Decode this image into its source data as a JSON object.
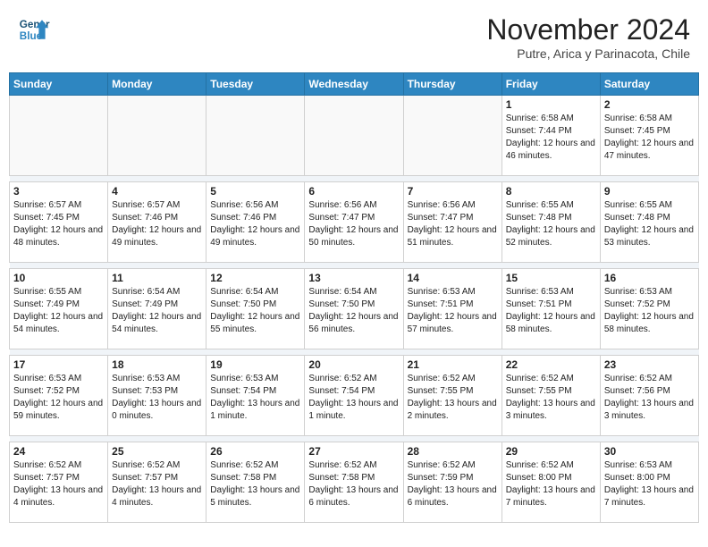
{
  "header": {
    "logo_line1": "General",
    "logo_line2": "Blue",
    "month_title": "November 2024",
    "subtitle": "Putre, Arica y Parinacota, Chile"
  },
  "weekdays": [
    "Sunday",
    "Monday",
    "Tuesday",
    "Wednesday",
    "Thursday",
    "Friday",
    "Saturday"
  ],
  "weeks": [
    [
      {
        "day": "",
        "info": ""
      },
      {
        "day": "",
        "info": ""
      },
      {
        "day": "",
        "info": ""
      },
      {
        "day": "",
        "info": ""
      },
      {
        "day": "",
        "info": ""
      },
      {
        "day": "1",
        "info": "Sunrise: 6:58 AM\nSunset: 7:44 PM\nDaylight: 12 hours and 46 minutes."
      },
      {
        "day": "2",
        "info": "Sunrise: 6:58 AM\nSunset: 7:45 PM\nDaylight: 12 hours and 47 minutes."
      }
    ],
    [
      {
        "day": "3",
        "info": "Sunrise: 6:57 AM\nSunset: 7:45 PM\nDaylight: 12 hours and 48 minutes."
      },
      {
        "day": "4",
        "info": "Sunrise: 6:57 AM\nSunset: 7:46 PM\nDaylight: 12 hours and 49 minutes."
      },
      {
        "day": "5",
        "info": "Sunrise: 6:56 AM\nSunset: 7:46 PM\nDaylight: 12 hours and 49 minutes."
      },
      {
        "day": "6",
        "info": "Sunrise: 6:56 AM\nSunset: 7:47 PM\nDaylight: 12 hours and 50 minutes."
      },
      {
        "day": "7",
        "info": "Sunrise: 6:56 AM\nSunset: 7:47 PM\nDaylight: 12 hours and 51 minutes."
      },
      {
        "day": "8",
        "info": "Sunrise: 6:55 AM\nSunset: 7:48 PM\nDaylight: 12 hours and 52 minutes."
      },
      {
        "day": "9",
        "info": "Sunrise: 6:55 AM\nSunset: 7:48 PM\nDaylight: 12 hours and 53 minutes."
      }
    ],
    [
      {
        "day": "10",
        "info": "Sunrise: 6:55 AM\nSunset: 7:49 PM\nDaylight: 12 hours and 54 minutes."
      },
      {
        "day": "11",
        "info": "Sunrise: 6:54 AM\nSunset: 7:49 PM\nDaylight: 12 hours and 54 minutes."
      },
      {
        "day": "12",
        "info": "Sunrise: 6:54 AM\nSunset: 7:50 PM\nDaylight: 12 hours and 55 minutes."
      },
      {
        "day": "13",
        "info": "Sunrise: 6:54 AM\nSunset: 7:50 PM\nDaylight: 12 hours and 56 minutes."
      },
      {
        "day": "14",
        "info": "Sunrise: 6:53 AM\nSunset: 7:51 PM\nDaylight: 12 hours and 57 minutes."
      },
      {
        "day": "15",
        "info": "Sunrise: 6:53 AM\nSunset: 7:51 PM\nDaylight: 12 hours and 58 minutes."
      },
      {
        "day": "16",
        "info": "Sunrise: 6:53 AM\nSunset: 7:52 PM\nDaylight: 12 hours and 58 minutes."
      }
    ],
    [
      {
        "day": "17",
        "info": "Sunrise: 6:53 AM\nSunset: 7:52 PM\nDaylight: 12 hours and 59 minutes."
      },
      {
        "day": "18",
        "info": "Sunrise: 6:53 AM\nSunset: 7:53 PM\nDaylight: 13 hours and 0 minutes."
      },
      {
        "day": "19",
        "info": "Sunrise: 6:53 AM\nSunset: 7:54 PM\nDaylight: 13 hours and 1 minute."
      },
      {
        "day": "20",
        "info": "Sunrise: 6:52 AM\nSunset: 7:54 PM\nDaylight: 13 hours and 1 minute."
      },
      {
        "day": "21",
        "info": "Sunrise: 6:52 AM\nSunset: 7:55 PM\nDaylight: 13 hours and 2 minutes."
      },
      {
        "day": "22",
        "info": "Sunrise: 6:52 AM\nSunset: 7:55 PM\nDaylight: 13 hours and 3 minutes."
      },
      {
        "day": "23",
        "info": "Sunrise: 6:52 AM\nSunset: 7:56 PM\nDaylight: 13 hours and 3 minutes."
      }
    ],
    [
      {
        "day": "24",
        "info": "Sunrise: 6:52 AM\nSunset: 7:57 PM\nDaylight: 13 hours and 4 minutes."
      },
      {
        "day": "25",
        "info": "Sunrise: 6:52 AM\nSunset: 7:57 PM\nDaylight: 13 hours and 4 minutes."
      },
      {
        "day": "26",
        "info": "Sunrise: 6:52 AM\nSunset: 7:58 PM\nDaylight: 13 hours and 5 minutes."
      },
      {
        "day": "27",
        "info": "Sunrise: 6:52 AM\nSunset: 7:58 PM\nDaylight: 13 hours and 6 minutes."
      },
      {
        "day": "28",
        "info": "Sunrise: 6:52 AM\nSunset: 7:59 PM\nDaylight: 13 hours and 6 minutes."
      },
      {
        "day": "29",
        "info": "Sunrise: 6:52 AM\nSunset: 8:00 PM\nDaylight: 13 hours and 7 minutes."
      },
      {
        "day": "30",
        "info": "Sunrise: 6:53 AM\nSunset: 8:00 PM\nDaylight: 13 hours and 7 minutes."
      }
    ]
  ]
}
